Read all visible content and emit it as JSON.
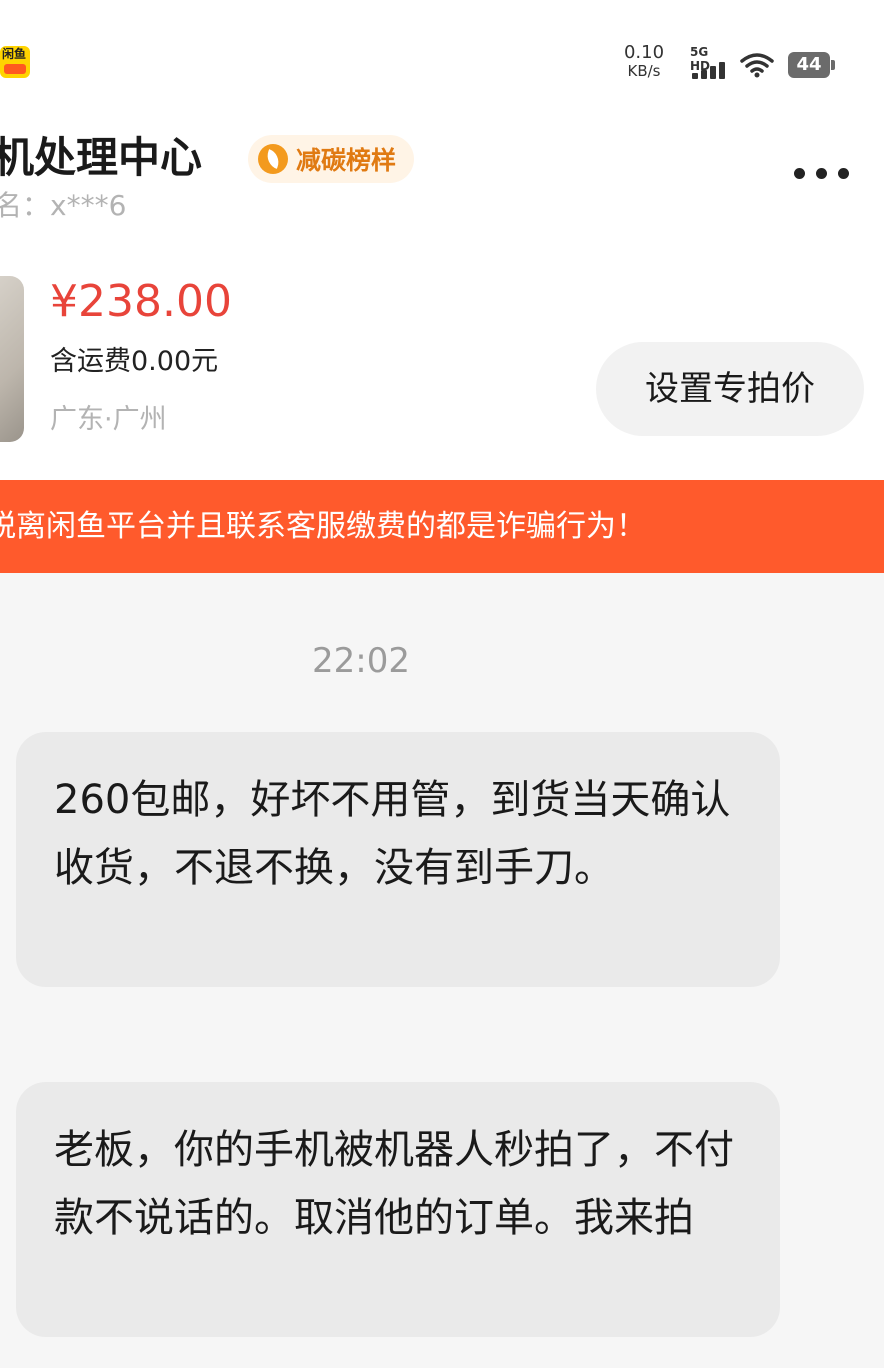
{
  "status_bar": {
    "app_icon_text": "闲鱼",
    "net_speed": "0.10",
    "net_speed_unit": "KB/s",
    "signal_label": "5G HD",
    "battery": "44"
  },
  "header": {
    "title": "机处理中心",
    "badge": "减碳榜样",
    "subtitle": "名：x***6"
  },
  "product": {
    "price": "¥238.00",
    "shipping": "含运费0.00元",
    "location": "广东·广州",
    "set_price_button": "设置专拍价"
  },
  "warning": "脱离闲鱼平台并且联系客服缴费的都是诈骗行为！",
  "chat": {
    "timestamp": "22:02",
    "messages": [
      "260包邮，好坏不用管，到货当天确认收货，不退不换，没有到手刀。",
      "老板，你的手机被机器人秒拍了，不付款不说话的。取消他的订单。我来拍"
    ]
  }
}
